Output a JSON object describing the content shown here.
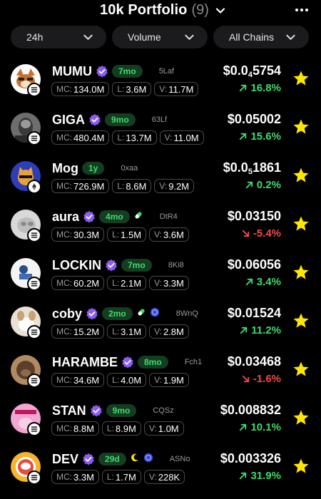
{
  "header": {
    "title": "10k Portfolio",
    "count": "(9)"
  },
  "filters": {
    "timeframe": "24h",
    "sort": "Volume",
    "chains": "All Chains"
  },
  "colors": {
    "green": "#3ddc6a",
    "red": "#f04a4a",
    "star": "#ffe600",
    "verified": "#8b5cf6"
  },
  "tokens": [
    {
      "name": "MUMU",
      "age": "7mo",
      "addr": "5Laf",
      "mc_k": "MC:",
      "mc": "134.0M",
      "l_k": "L:",
      "l": "3.6M",
      "v_k": "V:",
      "v": "11.7M",
      "price_pre": "$0.0",
      "price_sub": "4",
      "price_post": "5754",
      "change": "16.8%",
      "dir": "up",
      "verified": true,
      "chain": "solana",
      "avatar": "mumu"
    },
    {
      "name": "GIGA",
      "age": "9mo",
      "addr": "63Lf",
      "mc_k": "MC:",
      "mc": "480.4M",
      "l_k": "L:",
      "l": "13.7M",
      "v_k": "V:",
      "v": "11.0M",
      "price_pre": "$0.05002",
      "price_sub": "",
      "price_post": "",
      "change": "15.6%",
      "dir": "up",
      "verified": true,
      "chain": "solana",
      "avatar": "giga"
    },
    {
      "name": "Mog",
      "age": "1y",
      "addr": "0xaa",
      "mc_k": "MC:",
      "mc": "726.9M",
      "l_k": "L:",
      "l": "8.6M",
      "v_k": "V:",
      "v": "9.2M",
      "price_pre": "$0.0",
      "price_sub": "5",
      "price_post": "1861",
      "change": "0.2%",
      "dir": "up",
      "verified": false,
      "chain": "ethereum",
      "avatar": "mog"
    },
    {
      "name": "aura",
      "age": "4mo",
      "addr": "DtR4",
      "mc_k": "MC:",
      "mc": "30.3M",
      "l_k": "L:",
      "l": "1.5M",
      "v_k": "V:",
      "v": "3.6M",
      "price_pre": "$0.03150",
      "price_sub": "",
      "price_post": "",
      "change": "-5.4%",
      "dir": "down",
      "verified": true,
      "chain": "solana",
      "avatar": "aura",
      "extras": [
        "pill"
      ]
    },
    {
      "name": "LOCKIN",
      "age": "7mo",
      "addr": "8Ki8",
      "mc_k": "MC:",
      "mc": "60.2M",
      "l_k": "L:",
      "l": "2.1M",
      "v_k": "V:",
      "v": "3.3M",
      "price_pre": "$0.06056",
      "price_sub": "",
      "price_post": "",
      "change": "3.4%",
      "dir": "up",
      "verified": true,
      "chain": "solana",
      "avatar": "lockin"
    },
    {
      "name": "coby",
      "age": "2mo",
      "addr": "8WnQ",
      "mc_k": "MC:",
      "mc": "15.2M",
      "l_k": "L:",
      "l": "3.1M",
      "v_k": "V:",
      "v": "2.8M",
      "price_pre": "$0.01524",
      "price_sub": "",
      "price_post": "",
      "change": "11.2%",
      "dir": "up",
      "verified": true,
      "chain": "solana",
      "avatar": "coby",
      "extras": [
        "pill",
        "coin"
      ]
    },
    {
      "name": "HARAMBE",
      "age": "8mo",
      "addr": "Fch1",
      "mc_k": "MC:",
      "mc": "34.6M",
      "l_k": "L:",
      "l": "4.0M",
      "v_k": "V:",
      "v": "1.9M",
      "price_pre": "$0.03468",
      "price_sub": "",
      "price_post": "",
      "change": "-1.6%",
      "dir": "down",
      "verified": true,
      "chain": "solana",
      "avatar": "harambe"
    },
    {
      "name": "STAN",
      "age": "9mo",
      "addr": "CQSz",
      "mc_k": "MC:",
      "mc": "8.8M",
      "l_k": "L:",
      "l": "8.9M",
      "v_k": "V:",
      "v": "1.0M",
      "price_pre": "$0.008832",
      "price_sub": "",
      "price_post": "",
      "change": "10.1%",
      "dir": "up",
      "verified": true,
      "chain": "solana",
      "avatar": "stan"
    },
    {
      "name": "DEV",
      "age": "29d",
      "addr": "ASNo",
      "mc_k": "MC:",
      "mc": "3.3M",
      "l_k": "L:",
      "l": "1.7M",
      "v_k": "V:",
      "v": "228K",
      "price_pre": "$0.003326",
      "price_sub": "",
      "price_post": "",
      "change": "31.9%",
      "dir": "up",
      "verified": true,
      "chain": "solana",
      "avatar": "dev",
      "extras": [
        "moon",
        "coin"
      ]
    }
  ]
}
